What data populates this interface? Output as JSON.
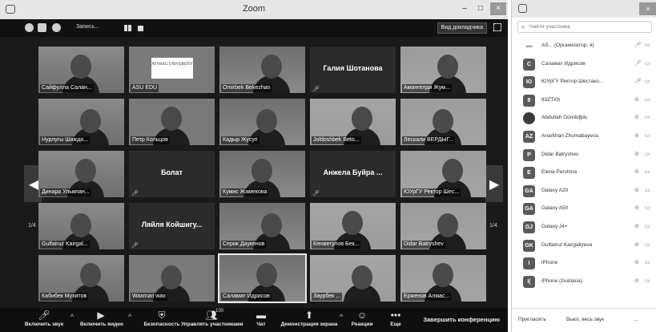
{
  "window": {
    "title": "Zoom",
    "minimize": "–",
    "maximize": "□",
    "close": "×"
  },
  "topbar": {
    "recording_label": "Запись...",
    "speaker_view_label": "Вид докладчика"
  },
  "gallery": {
    "page_left": "1/4",
    "page_right": "1/4",
    "tiles": [
      "Сайфулла Салан...",
      "ASU EDU",
      "Omirbek Bekezhan",
      "Галия Шотанова",
      "Амангелди Жум...",
      "Нурлугы Шаждо...",
      "Петр Кольцов",
      "Кадыр Жусуп",
      "Joldoshbek Beto...",
      "Лескали ВЕРДЫГ...",
      "Динара Улыкпан...",
      "Болат",
      "Кумис Жамекова",
      "Анжела Буйра ...",
      "ЮУрГУ Ректор Шес...",
      "Gulfairuz Kairgal...",
      "Ляйля Койшигу...",
      "Серик Даукенов",
      "Кенжегулов Бек...",
      "Didar Batryshev",
      "Кабибек Мухитов",
      "Waxman wax",
      "Саламат Идрисов",
      "Заурбек ...",
      "Ерженов Алмас..."
    ],
    "logo_text": "ATYRAU UNIVERSITY"
  },
  "bottombar": {
    "unmute": "Включить звук",
    "start_video": "Включить видео",
    "security": "Безопасность",
    "manage_participants": "Управлять участниками",
    "participants_count": "100",
    "chat": "Чат",
    "share_screen": "Демонстрация экрана",
    "reactions": "Реакции",
    "more": "Еще",
    "end_meeting": "Завершить конференцию"
  },
  "panel": {
    "search_placeholder": "Найти участника",
    "close": "×",
    "participants": [
      {
        "avatar": "ASU",
        "name": "AS... (Организатор, я)"
      },
      {
        "avatar": "С",
        "name": "Саламат Идрисов"
      },
      {
        "avatar": "Ю",
        "name": "ЮУрГУ Ректор Шестако..."
      },
      {
        "avatar": "8",
        "name": "83ZTXh"
      },
      {
        "avatar": "",
        "name": "Abdullah Gündoğdu"
      },
      {
        "avatar": "AZ",
        "name": "Anarkhan Zhumabayeva"
      },
      {
        "avatar": "P",
        "name": "Didar Batryshev"
      },
      {
        "avatar": "E",
        "name": "Elena Pershina"
      },
      {
        "avatar": "GA",
        "name": "Galaxy A20"
      },
      {
        "avatar": "GA",
        "name": "Galaxy A50"
      },
      {
        "avatar": "GJ",
        "name": "Galaxy J4+"
      },
      {
        "avatar": "GK",
        "name": "Gulfairuz Kairgaliyeva"
      },
      {
        "avatar": "I",
        "name": "iPhone"
      },
      {
        "avatar": "I(",
        "name": "iPhone (Guldana)"
      }
    ],
    "invite": "Пригласить",
    "mute_all": "Выкл. весь звук",
    "more": "..."
  }
}
